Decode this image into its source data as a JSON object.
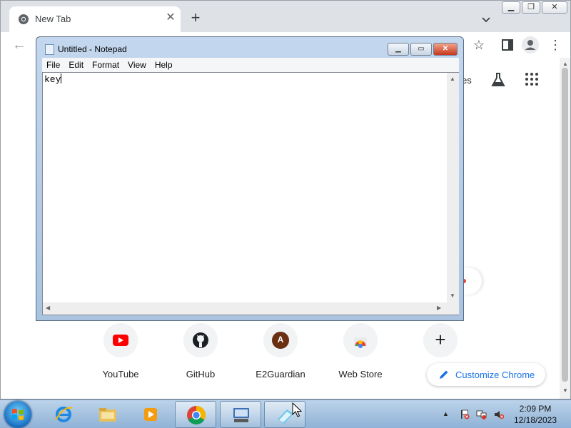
{
  "browser": {
    "tab_title": "New Tab",
    "tab_close": "✕",
    "new_tab": "+",
    "window_controls": {
      "minimize": "▁",
      "maximize": "❐",
      "close": "✕"
    },
    "back": "←",
    "star": "☆",
    "menu": "⋮"
  },
  "ntp": {
    "images_link": "es",
    "shortcuts": [
      {
        "label": "YouTube",
        "icon": "youtube-icon"
      },
      {
        "label": "GitHub",
        "icon": "github-icon"
      },
      {
        "label": "E2Guardian",
        "icon": "letter-avatar",
        "letter": "A"
      },
      {
        "label": "Web Store",
        "icon": "webstore-icon"
      },
      {
        "label": "Add",
        "icon": "plus-icon",
        "glyph": "+"
      }
    ],
    "customize_label": "Customize Chrome",
    "scroll_up": "▲",
    "scroll_down": "▼"
  },
  "notepad": {
    "title": "Untitled - Notepad",
    "menus": [
      "File",
      "Edit",
      "Format",
      "View",
      "Help"
    ],
    "content": "key",
    "controls": {
      "minimize": "▁",
      "maximize": "▭",
      "close": "✕"
    },
    "arrows": {
      "up": "▲",
      "down": "▼",
      "left": "◀",
      "right": "▶"
    }
  },
  "taskbar": {
    "pinned": [
      "start-orb",
      "internet-explorer-icon",
      "file-explorer-icon",
      "media-player-icon",
      "chrome-icon",
      "on-screen-keyboard-icon",
      "notepad-icon"
    ],
    "active": [
      "chrome-icon",
      "on-screen-keyboard-icon",
      "notepad-icon"
    ],
    "tray_arrow": "▲",
    "time": "2:09 PM",
    "date": "12/18/2023"
  },
  "colors": {
    "chrome_accent": "#1a73e8",
    "youtube_red": "#ff0000",
    "avatar_brown": "#6b2f12",
    "notepad_close_red": "#c6361a"
  }
}
